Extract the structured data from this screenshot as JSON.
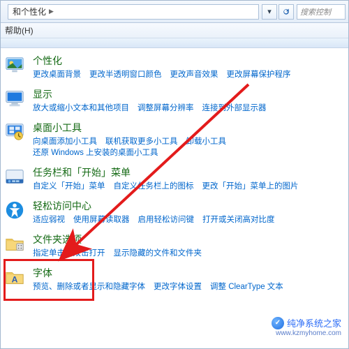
{
  "address_bar": {
    "breadcrumb_suffix": "和个性化",
    "search_placeholder": "搜索控制"
  },
  "menubar": {
    "help": "帮助(H)"
  },
  "categories": [
    {
      "key": "personalization",
      "title": "个性化",
      "icon": "personalization-icon",
      "links": [
        "更改桌面背景",
        "更改半透明窗口颜色",
        "更改声音效果",
        "更改屏幕保护程序"
      ]
    },
    {
      "key": "display",
      "title": "显示",
      "icon": "display-icon",
      "links": [
        "放大或缩小文本和其他项目",
        "调整屏幕分辨率",
        "连接到外部显示器"
      ]
    },
    {
      "key": "gadgets",
      "title": "桌面小工具",
      "icon": "gadgets-icon",
      "links": [
        "向桌面添加小工具",
        "联机获取更多小工具",
        "卸载小工具",
        "还原 Windows 上安装的桌面小工具"
      ]
    },
    {
      "key": "taskbar",
      "title": "任务栏和「开始」菜单",
      "icon": "taskbar-icon",
      "links": [
        "自定义「开始」菜单",
        "自定义任务栏上的图标",
        "更改「开始」菜单上的图片"
      ]
    },
    {
      "key": "ease",
      "title": "轻松访问中心",
      "icon": "ease-icon",
      "links": [
        "适应弱视",
        "使用屏幕读取器",
        "启用轻松访问键",
        "打开或关闭高对比度"
      ]
    },
    {
      "key": "folder",
      "title": "文件夹选项",
      "icon": "folder-icon",
      "links": [
        "指定单击或双击打开",
        "显示隐藏的文件和文件夹"
      ]
    },
    {
      "key": "fonts",
      "title": "字体",
      "icon": "fonts-icon",
      "links": [
        "预览、删除或者显示和隐藏字体",
        "更改字体设置",
        "调整 ClearType 文本"
      ]
    }
  ],
  "watermark": {
    "title": "纯净系统之家",
    "url": "www.kzmyhome.com"
  }
}
